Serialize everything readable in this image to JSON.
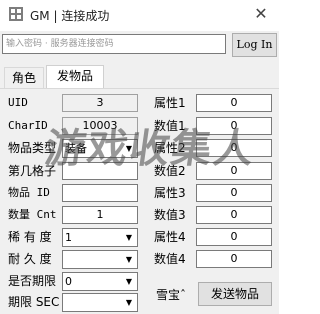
{
  "window": {
    "title": "GM | 连接成功",
    "close_glyph": "✕"
  },
  "login": {
    "password_placeholder": "输入密码 · 服务器连接密码",
    "login_label": "Log In"
  },
  "tabs": [
    {
      "label": "角色",
      "active": false
    },
    {
      "label": "发物品",
      "active": true
    }
  ],
  "left_form": {
    "uid_label": "UID",
    "uid_value": "3",
    "charid_label": "CharID",
    "charid_value": "10003",
    "item_type_label": "物品类型",
    "item_type_value": "装备",
    "slot_label": "第几格子",
    "slot_value": "",
    "item_id_label": "物品  ID",
    "item_id_value": "",
    "count_label": "数量 Cnt",
    "count_value": "1",
    "rarity_label": "稀 有 度",
    "rarity_value": "1",
    "durability_label": "耐 久 度",
    "durability_value": "",
    "expire_label": "是否期限",
    "expire_value": "0",
    "period_label": "期限 SEC",
    "period_value": ""
  },
  "right_form": {
    "attr1_label": "属性1",
    "attr1_value": "0",
    "val1_label": "数值1",
    "val1_value": "0",
    "attr2_label": "属性2",
    "attr2_value": "0",
    "val2_label": "数值2",
    "val2_value": "0",
    "attr3_label": "属性3",
    "attr3_value": "0",
    "val3_label": "数值3",
    "val3_value": "0",
    "attr4_label": "属性4",
    "attr4_value": "0",
    "val4_label": "数值4",
    "val4_value": "0",
    "snow_label": "雪宝ˆ",
    "send_label": "发送物品"
  },
  "watermark": "游戏收集人",
  "colors": {
    "panel_bg": "#f0f0f0",
    "button_bg": "#e1e1e1",
    "border": "#7a7a7a",
    "watermark": "#464646"
  }
}
